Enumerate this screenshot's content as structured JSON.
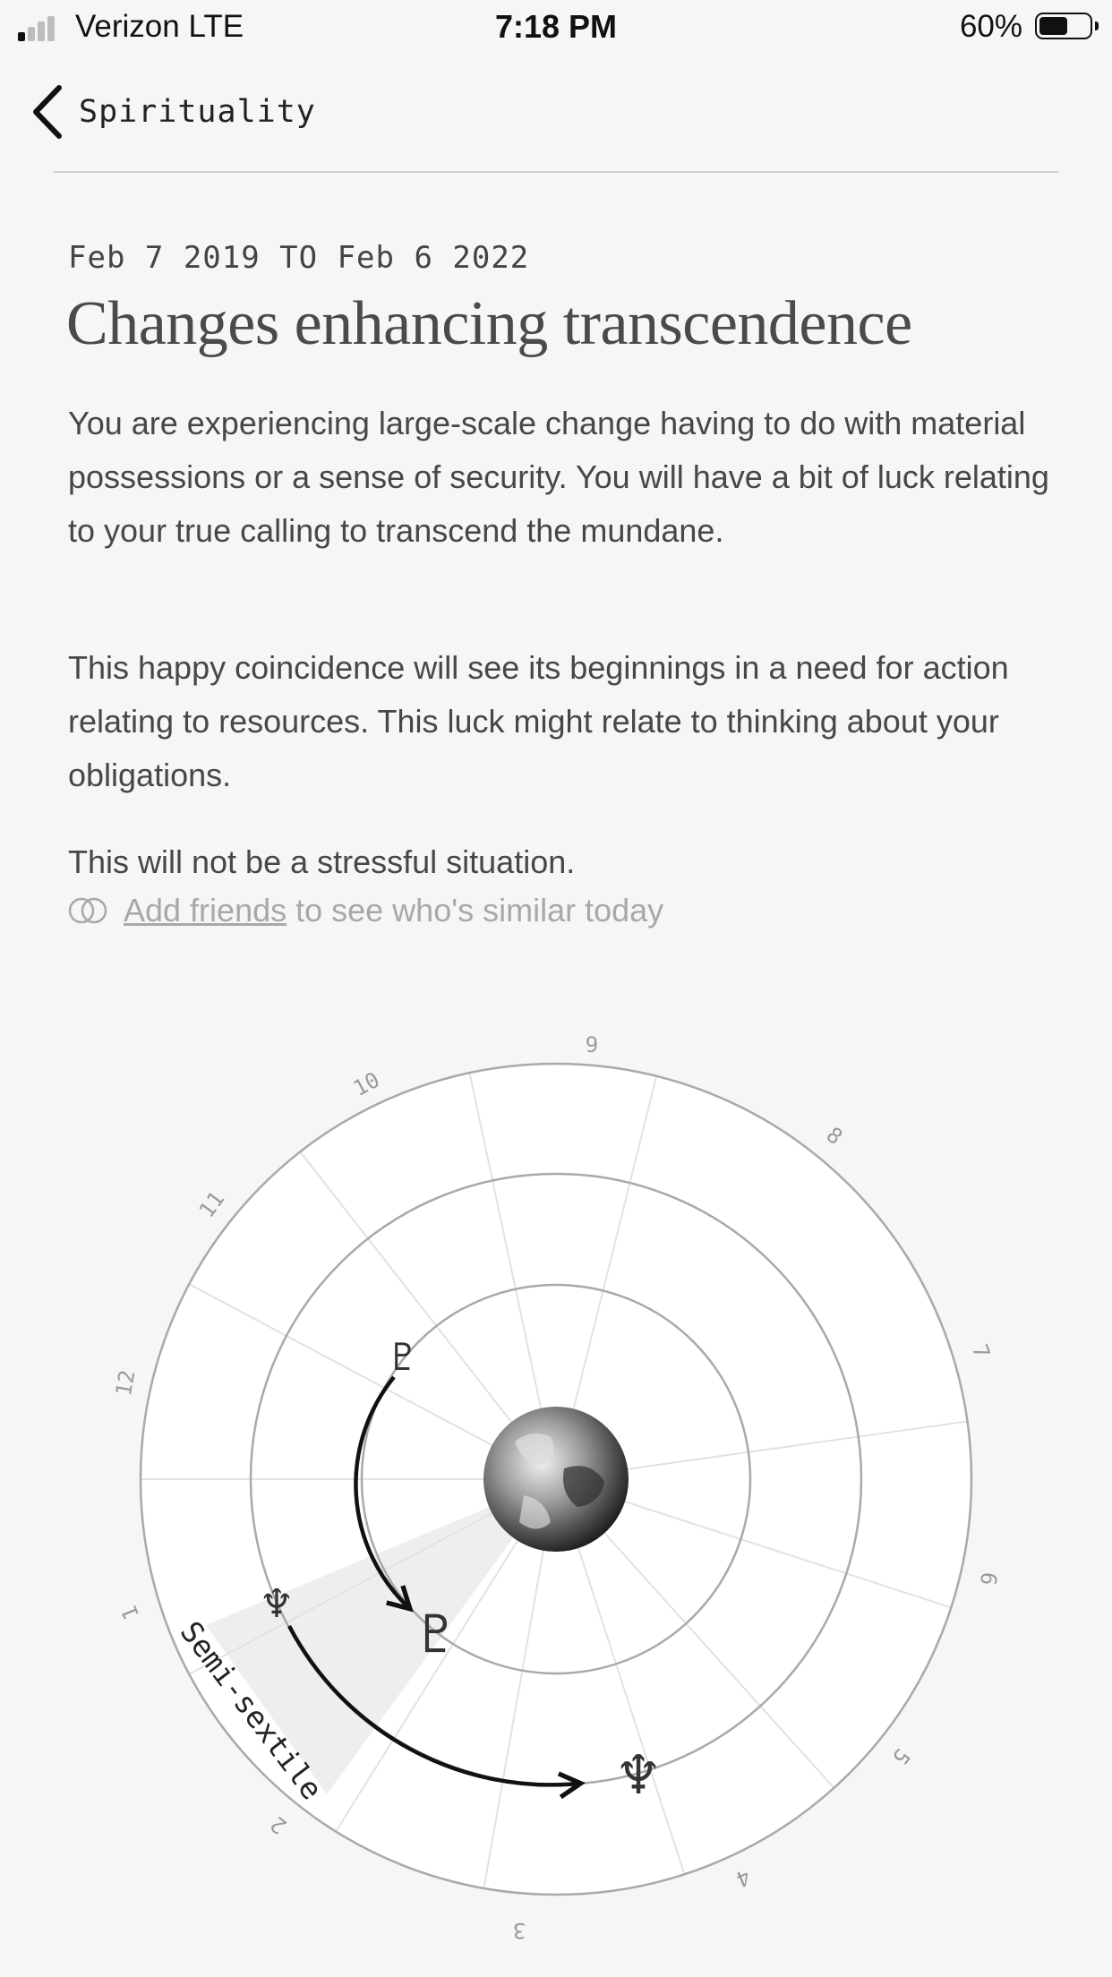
{
  "status_bar": {
    "carrier": "Verizon  LTE",
    "time": "7:18 PM",
    "battery_percent": "60%",
    "signal_bars_active": 1,
    "battery_level": 0.6
  },
  "nav": {
    "back_icon": "chevron-left-icon",
    "title": "Spirituality"
  },
  "card": {
    "date_range": "Feb 7 2019 TO Feb 6 2022",
    "headline": "Changes enhancing transcendence",
    "paragraphs": [
      "You are experiencing large-scale change having to do with material possessions or a sense of security. You will have a bit of luck relating to your true calling to transcend the mundane.",
      "This happy coincidence will see its beginnings in a need for action relating to resources. This luck might relate to thinking about your obligations.",
      "This will not be a stressful situation."
    ],
    "friends_icon": "overlapping-circles-icon",
    "friends_link": "Add friends",
    "friends_rest": "to see who's similar today"
  },
  "chart": {
    "house_numbers": [
      "1",
      "2",
      "3",
      "4",
      "5",
      "6",
      "7",
      "8",
      "9",
      "10",
      "11",
      "12"
    ],
    "aspect": "Semi-sextile",
    "planets": {
      "pluto": "♇",
      "neptune": "♆"
    },
    "center_icon": "earth-globe-icon",
    "colors": {
      "ring": "#a9a9a9",
      "spoke": "#e2e2e2",
      "arrow": "#111111",
      "wedge": "#ececec"
    }
  }
}
